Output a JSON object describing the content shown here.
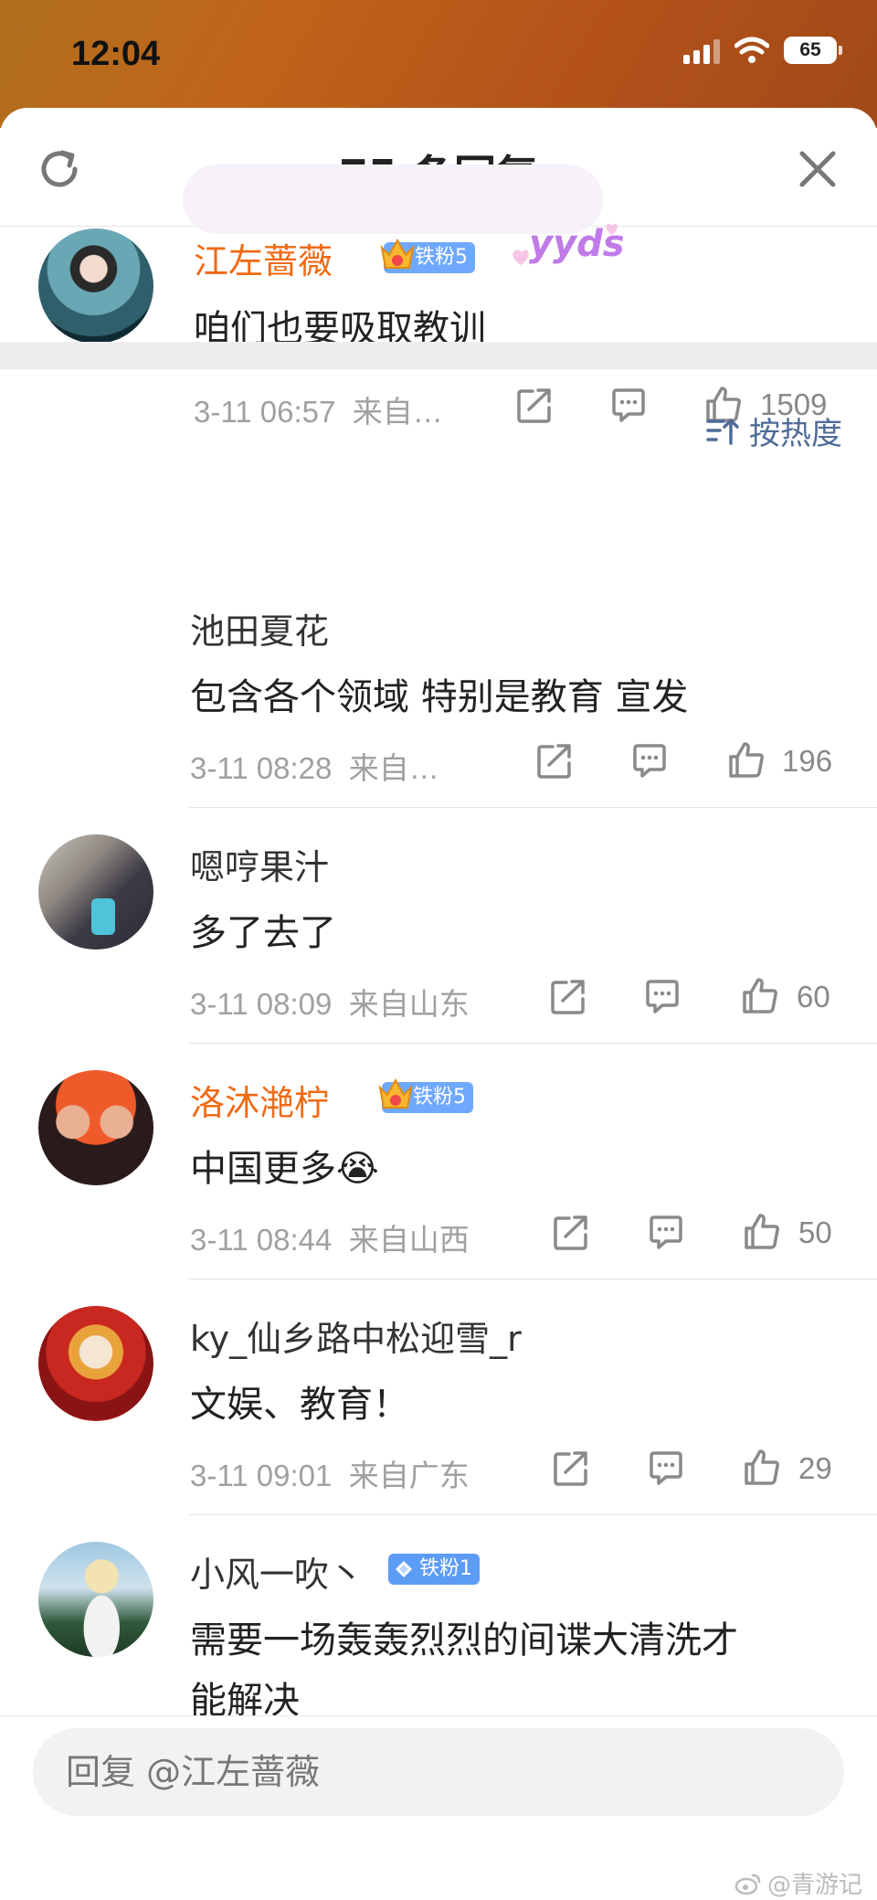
{
  "status_bar": {
    "time": "12:04",
    "battery": "65"
  },
  "header": {
    "title": "75 条回复"
  },
  "root_comment": {
    "username": "江左蔷薇",
    "badge": "铁粉5",
    "text": "咱们也要吸取教训",
    "sticker_text": "yyds",
    "time": "3-11 06:57",
    "source": "来自…",
    "likes": "1509"
  },
  "sort": {
    "label": "按热度"
  },
  "replies": [
    {
      "username": "池田夏花",
      "text": "包含各个领域 特别是教育 宣发",
      "time": "3-11 08:28",
      "source": "来自…",
      "likes": "196"
    },
    {
      "username": "嗯哼果汁",
      "text": "多了去了",
      "time": "3-11 08:09",
      "source": "来自山东",
      "likes": "60"
    },
    {
      "username": "洛沐滟柠",
      "badge": "铁粉5",
      "text": "中国更多",
      "emoji": "😭",
      "time": "3-11 08:44",
      "source": "来自山西",
      "likes": "50"
    },
    {
      "username": "ky_仙乡路中松迎雪_r",
      "text": "文娱、教育！",
      "time": "3-11 09:01",
      "source": "来自广东",
      "likes": "29"
    },
    {
      "username": "小风一吹丶",
      "badge": "铁粉1",
      "text_line1": "需要一场轰轰烈烈的间谍大清洗才",
      "text_line2": "能解决"
    }
  ],
  "reply_input": {
    "placeholder": "回复 @江左蔷薇"
  },
  "watermark": "@青游记",
  "colors": {
    "vip_name": "#f06a14",
    "badge_blue": "#6fa8ff",
    "sort_blue": "#4f6b99"
  }
}
